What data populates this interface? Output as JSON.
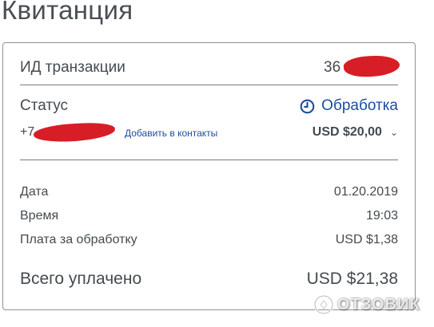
{
  "header": {
    "title": "Квитанция"
  },
  "receipt": {
    "transaction_label": "ИД транзакции",
    "transaction_id_visible": "36",
    "status_label": "Статус",
    "status_value": "Обработка",
    "status_icon": "clock-icon",
    "phone_prefix": "+7",
    "add_contact_label": "Добавить в контакты",
    "amount": "USD $20,00",
    "chevron": "⌄",
    "date_label": "Дата",
    "date_value": "01.20.2019",
    "time_label": "Время",
    "time_value": "19:03",
    "fee_label": "Плата за обработку",
    "fee_value": "USD $1,38",
    "total_label": "Всего уплачено",
    "total_value": "USD $21,38"
  },
  "watermark": {
    "text": "ОТЗОВИК"
  },
  "colors": {
    "accent_blue": "#1b4d9e",
    "redaction_red": "#d71e26",
    "text_gray": "#444a4f",
    "border": "#8e9296"
  }
}
